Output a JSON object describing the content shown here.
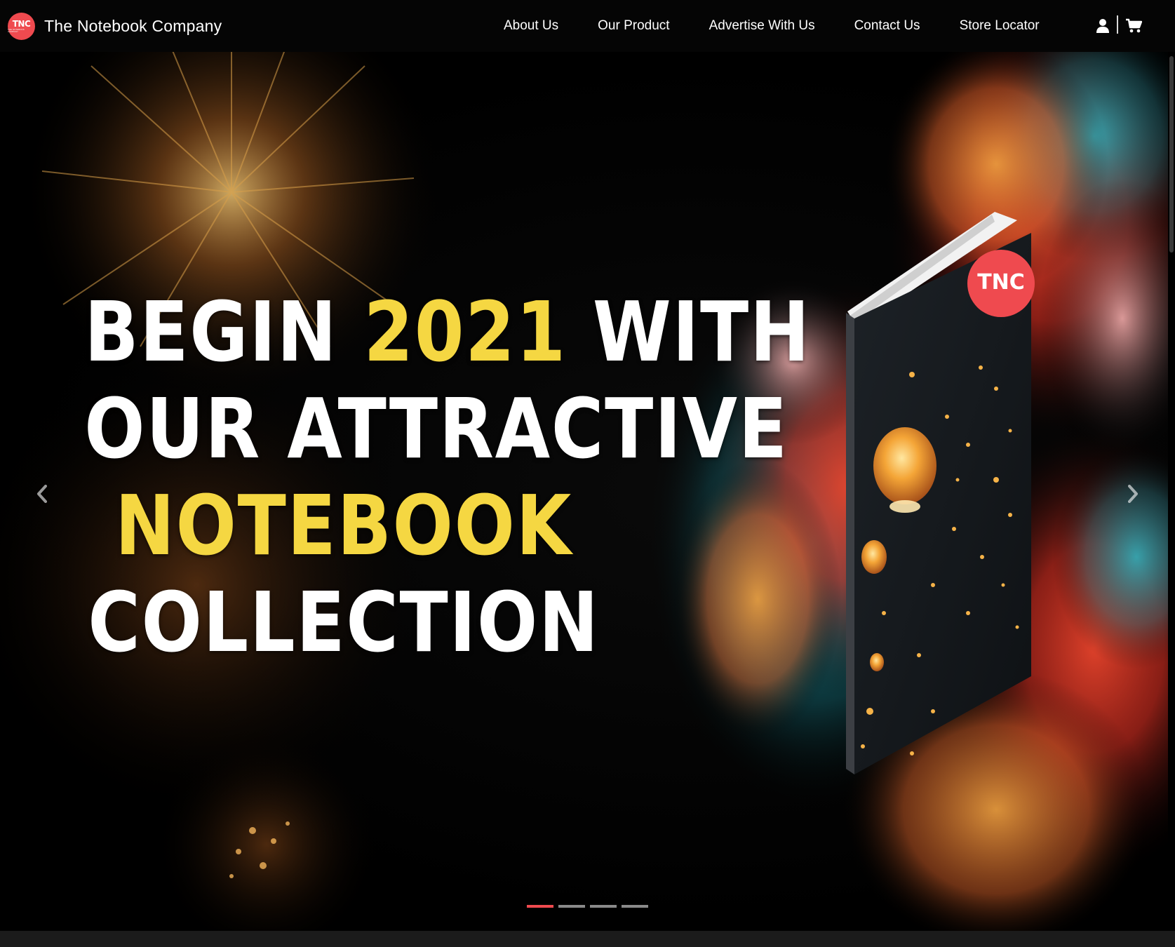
{
  "brand": {
    "logo_text": "TNC",
    "logo_subtext": "THE NOTEBOOK COMPANY",
    "name": "The Notebook Company"
  },
  "nav": {
    "items": [
      {
        "label": "About Us"
      },
      {
        "label": "Our Product"
      },
      {
        "label": "Advertise With Us"
      },
      {
        "label": "Contact Us"
      },
      {
        "label": "Store Locator"
      }
    ],
    "icons": [
      "user-icon",
      "cart-icon"
    ]
  },
  "hero": {
    "line1_a": "BEGIN ",
    "line1_year": "2021",
    "line1_b": " WITH",
    "line2": "OUR ATTRACTIVE",
    "line3": "NOTEBOOK",
    "line4": "COLLECTION",
    "book_logo_text": "TNC",
    "carousel": {
      "slide_count": 4,
      "active_index": 0
    }
  },
  "colors": {
    "brand_red": "#ef4a4f",
    "highlight_yellow": "#f5d742",
    "nav_bg": "#050505"
  }
}
